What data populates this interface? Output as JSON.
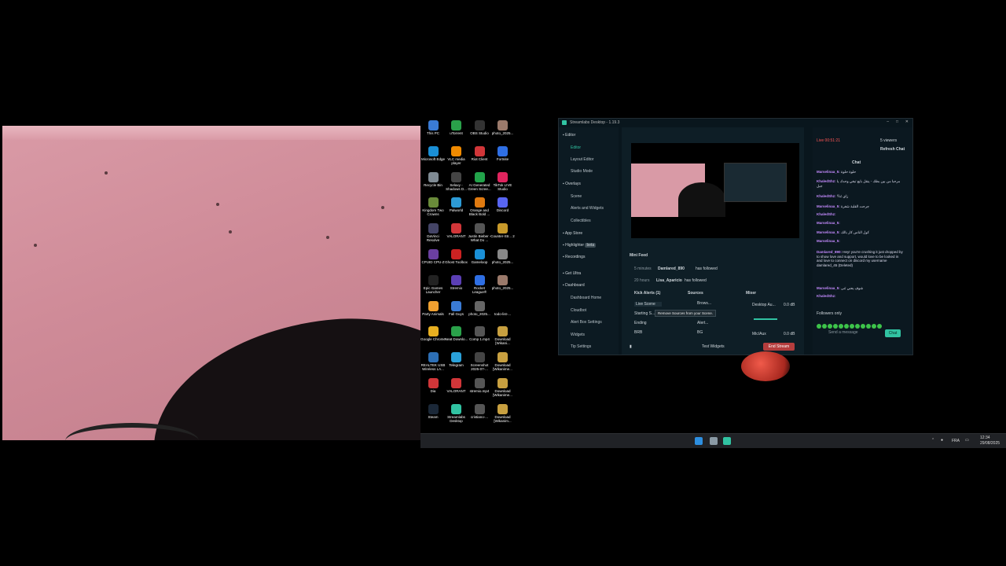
{
  "desktop": {
    "icons": [
      {
        "label": "This PC",
        "color": "#3a7bd5"
      },
      {
        "label": "uTorrent",
        "color": "#2aa14a"
      },
      {
        "label": "OBS Studio",
        "color": "#333333"
      },
      {
        "label": "photo_2025...",
        "color": "#9b7a6b"
      },
      {
        "label": "Microsoft Edge",
        "color": "#1a8fd6"
      },
      {
        "label": "VLC media player",
        "color": "#f08a00"
      },
      {
        "label": "Riot Client",
        "color": "#d13639"
      },
      {
        "label": "Fortnite",
        "color": "#2f6fe4"
      },
      {
        "label": "Recycle Bin",
        "color": "#7f8a93"
      },
      {
        "label": "Selaxy - Shadows D...",
        "color": "#444444"
      },
      {
        "label": "AI Generated Green Scree...",
        "color": "#22a34a"
      },
      {
        "label": "TikTok LIVE Studio",
        "color": "#e0245e"
      },
      {
        "label": "Kingdom Two Crowns",
        "color": "#6a8b3a"
      },
      {
        "label": "Palworld",
        "color": "#2d9bd6"
      },
      {
        "label": "Orange and Black Bold ...",
        "color": "#e07a10"
      },
      {
        "label": "Discord",
        "color": "#5865f2"
      },
      {
        "label": "DaVinci Resolve",
        "color": "#444466"
      },
      {
        "label": "VALORANT",
        "color": "#d13639"
      },
      {
        "label": "Justin Bieber - What Do ...",
        "color": "#555555"
      },
      {
        "label": "Counter-Str... 2",
        "color": "#c89a2a"
      },
      {
        "label": "CPUID CPU-Z",
        "color": "#6b3fa0"
      },
      {
        "label": "Ghost Toolbox",
        "color": "#cc2222"
      },
      {
        "label": "Gameloop",
        "color": "#1a8fd6"
      },
      {
        "label": "photo_2025...",
        "color": "#888888"
      },
      {
        "label": "Epic Games Launcher",
        "color": "#222222"
      },
      {
        "label": "Stremio",
        "color": "#5b3fb5"
      },
      {
        "label": "Rocket League®",
        "color": "#2f6fe4"
      },
      {
        "label": "photo_2025...",
        "color": "#9b7a6b"
      },
      {
        "label": "Party Animals",
        "color": "#f0a030"
      },
      {
        "label": "Fall Guys",
        "color": "#3a7bd5"
      },
      {
        "label": "photo_2025...",
        "color": "#666666"
      },
      {
        "label": "todo-list-...",
        "color": "#000000"
      },
      {
        "label": "Google Chrome",
        "color": "#e8b021"
      },
      {
        "label": "Neat Downlo...",
        "color": "#2aa14a"
      },
      {
        "label": "Comp 1.mp4",
        "color": "#555555"
      },
      {
        "label": "Download [Wikani...",
        "color": "#c8a040"
      },
      {
        "label": "REALTEK USB Wireless LA...",
        "color": "#2d6fb5"
      },
      {
        "label": "Telegram",
        "color": "#2aa1d9"
      },
      {
        "label": "Screenshot 2025-07-...",
        "color": "#444444"
      },
      {
        "label": "Download [Wikanime...",
        "color": "#c8a040"
      },
      {
        "label": "Dia",
        "color": "#d13639"
      },
      {
        "label": "VALORANT",
        "color": "#d13639"
      },
      {
        "label": "stremio.mp4",
        "color": "#555555"
      },
      {
        "label": "Download [Wikanime...",
        "color": "#c8a040"
      },
      {
        "label": "Steam",
        "color": "#1b2838"
      },
      {
        "label": "Streamlabs Desktop",
        "color": "#31c3a2"
      },
      {
        "label": "cristiano-...",
        "color": "#555555"
      },
      {
        "label": "Download [Wikanim...",
        "color": "#c8a040"
      }
    ]
  },
  "taskbar": {
    "lang": "FRA",
    "time": "12:34",
    "date": "29/08/2025"
  },
  "streamlabs": {
    "title": "Streamlabs Desktop - 1.19.3",
    "nav": {
      "editor": "Editor",
      "editor_sub": [
        "Editor",
        "Layout Editor",
        "Studio Mode"
      ],
      "overlays": "Overlays",
      "overlays_sub": [
        "Scene",
        "Alerts and Widgets",
        "Collectibles"
      ],
      "app_store": "App Store",
      "highlighter": "Highlighter",
      "beta": "beta",
      "recordings": "Recordings",
      "get_ultra": "Get Ultra",
      "dashboard": "Dashboard",
      "dashboard_sub": [
        "Dashboard Home",
        "Cloudbot",
        "Alert Box Settings",
        "Widgets",
        "Tip Settings"
      ]
    },
    "mini_feed": {
      "title": "Mini Feed",
      "events": [
        {
          "time": "5 minutes",
          "user": "Damlared_890",
          "action": "has followed"
        },
        {
          "time": "20 hours",
          "user": "Lisa_Aparicio",
          "action": "has followed"
        }
      ]
    },
    "scenes": {
      "title": "Kick Alerts (1)",
      "items": [
        "Live Scene",
        "Starting S...",
        "Ending",
        "BRB"
      ]
    },
    "sources": {
      "title": "Sources",
      "items": [
        "Brows...",
        "Alert...",
        "BG"
      ],
      "tooltip": "Remove Sources from your Scene."
    },
    "mixer": {
      "title": "Mixer",
      "channels": [
        {
          "name": "Desktop Au...",
          "db": "0.0 dB"
        },
        {
          "name": "Mic/Aux",
          "db": "0.0 dB"
        }
      ]
    },
    "footer": {
      "test_widgets": "Test Widgets",
      "end_stream": "End Stream"
    },
    "live": {
      "status": "Live 00:51:21",
      "viewers": "5 viewers",
      "refresh": "Refresh Chat"
    },
    "chat": {
      "title": "Chat",
      "messages": [
        {
          "user": "Marselinaa_5:",
          "text": "حلوة حلوة"
        },
        {
          "user": "KhaledShz:",
          "text": "مرحبا من بين بطك - ينقل بايع تبغي وحدك يا جبل"
        },
        {
          "user": "KhaledShz:",
          "text": "زاي ثنا؟"
        },
        {
          "user": "Marselinaa_5:",
          "text": "جرحت القلبة شغرة"
        },
        {
          "user": "KhaledShz:",
          "text": ""
        },
        {
          "user": "Marselinaa_5:",
          "text": ""
        },
        {
          "user": "Marselinaa_5:",
          "text": "كول الناس كار بالك"
        },
        {
          "user": "Marselinaa_5:",
          "text": ""
        },
        {
          "user": "Damlared_890:",
          "text": "Hey! you're crushing it just dropped by to show love and support, would love to be looked in and love to connect on discord my username damlared_45 (Deleted)"
        },
        {
          "user": "Marselinaa_5:",
          "text": "شوف يعني ثنى"
        },
        {
          "user": "KhaledShz:",
          "text": ""
        }
      ],
      "followers_only": "Followers only",
      "placeholder": "Send a message",
      "send": "Chat"
    }
  }
}
